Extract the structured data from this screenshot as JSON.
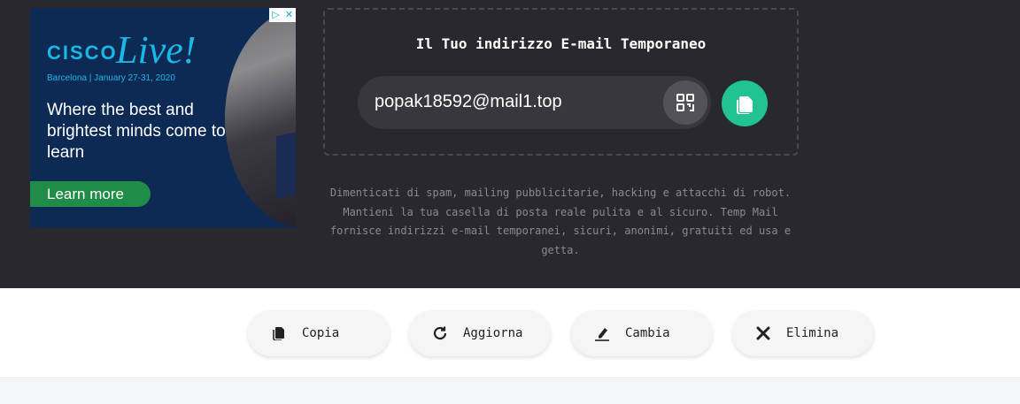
{
  "ad": {
    "brand": "CISCO",
    "brand_script": "Live!",
    "event": "Barcelona | January 27-31, 2020",
    "headline": "Where the best and brightest minds come to learn",
    "cta": "Learn more",
    "badge_icons": [
      "adchoices-icon",
      "close-icon"
    ]
  },
  "mailbox": {
    "title": "Il Tuo indirizzo E-mail Temporaneo",
    "email": "popak18592@mail1.top"
  },
  "description": "Dimenticati di spam, mailing pubblicitarie, hacking e attacchi di robot. Mantieni la tua casella di posta reale pulita e al sicuro. Temp Mail fornisce indirizzi e-mail temporanei, sicuri, anonimi, gratuiti ed usa e getta.",
  "actions": [
    {
      "label": "Copia",
      "icon": "copy-icon"
    },
    {
      "label": "Aggiorna",
      "icon": "refresh-icon"
    },
    {
      "label": "Cambia",
      "icon": "edit-icon"
    },
    {
      "label": "Elimina",
      "icon": "close-icon"
    }
  ],
  "colors": {
    "hero_bg": "#29282e",
    "accent": "#21c393",
    "ad_bg": "#0d2a55",
    "ad_cta": "#1f8d47"
  }
}
